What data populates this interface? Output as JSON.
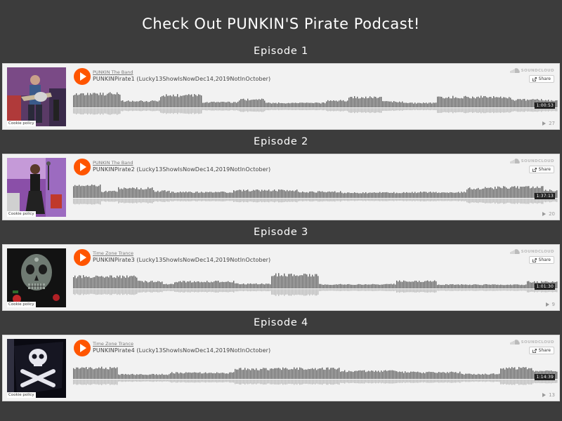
{
  "page": {
    "title": "Check Out PUNKIN'S Pirate Podcast!",
    "background_color": "#3c3c3c",
    "accent_color": "#ff5500"
  },
  "common": {
    "cookie_policy": "Cookie policy",
    "soundcloud_label": "SOUNDCLOUD",
    "share_label": "Share"
  },
  "episodes": [
    {
      "heading": "Episode 1",
      "artist": "PUNKIN The Band",
      "track_title": "PUNKINPirate1 (Lucky13ShowIsNowDec14,2019NotInOctober)",
      "duration": "1:00:53",
      "plays": "27",
      "artwork_icon": "guitarist-photo"
    },
    {
      "heading": "Episode 2",
      "artist": "PUNKIN The Band",
      "track_title": "PUNKINPirate2 (Lucky13ShowIsNowDec14,2019NotInOctober)",
      "duration": "1:37:13",
      "plays": "20",
      "artwork_icon": "singer-photo"
    },
    {
      "heading": "Episode 3",
      "artist": "Time Zone Trance",
      "track_title": "PUNKINPirate3 (Lucky13ShowIsNowDec14,2019NotInOctober)",
      "duration": "1:01:30",
      "plays": "9",
      "artwork_icon": "sugar-skull-art"
    },
    {
      "heading": "Episode 4",
      "artist": "Time Zone Trance",
      "track_title": "PUNKINPirate4 (Lucky13ShowIsNowDec14,2019NotInOctober)",
      "duration": "1:14:39",
      "plays": "13",
      "artwork_icon": "jolly-roger-flag"
    }
  ]
}
